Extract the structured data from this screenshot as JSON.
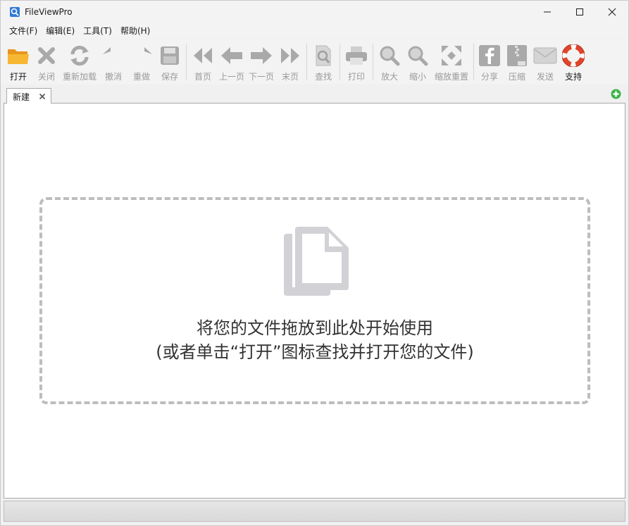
{
  "window": {
    "title": "FileViewPro",
    "controls": [
      "minimize",
      "maximize",
      "close"
    ]
  },
  "menu": [
    {
      "label": "文件(F)"
    },
    {
      "label": "编辑(E)"
    },
    {
      "label": "工具(T)"
    },
    {
      "label": "帮助(H)"
    }
  ],
  "toolbar": {
    "open": "打开",
    "close": "关闭",
    "reload": "重新加载",
    "undo": "撤消",
    "redo": "重做",
    "save": "保存",
    "first": "首页",
    "prev": "上一页",
    "next": "下一页",
    "last": "末页",
    "find": "查找",
    "print": "打印",
    "zoom_in": "放大",
    "zoom_out": "缩小",
    "zoom_reset": "缩放重置",
    "share": "分享",
    "compress": "压缩",
    "send": "发送",
    "support": "支持"
  },
  "tabs": [
    {
      "label": "新建"
    }
  ],
  "dropzone": {
    "line1": "将您的文件拖放到此处开始使用",
    "line2": "(或者单击“打开”图标查找并打开您的文件)"
  },
  "colors": {
    "accent_open": "#f5a623",
    "disabled_icon": "#a9a9a9",
    "support_ring": "#e0442b",
    "add_tab": "#3bb34a"
  }
}
